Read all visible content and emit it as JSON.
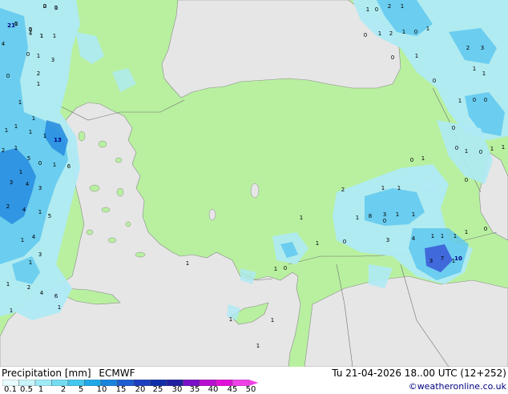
{
  "title": "Precipitation [mm]",
  "model": "ECMWF",
  "datetime": "Tu 21-04-2026 18..00 UTC (12+252)",
  "credit": "©weatheronline.co.uk",
  "colors": {
    "land": "#b8f0a0",
    "sea_outside": "#e6e6e6",
    "precip_light": "#aeeaf5",
    "precip_medium": "#5fc8ef",
    "precip_heavy": "#2a8fe0",
    "precip_intense": "#3c5ed8"
  },
  "colorbar": {
    "ticks": [
      "0.1",
      "0.5",
      "1",
      "2",
      "5",
      "10",
      "15",
      "20",
      "25",
      "30",
      "35",
      "40",
      "45",
      "50"
    ],
    "colors": [
      "#e8fbff",
      "#c8f4fb",
      "#9eeaf6",
      "#73dcf2",
      "#46c8ee",
      "#1ea8e8",
      "#1a84dc",
      "#1e5ed0",
      "#1e3ec0",
      "#102ea8",
      "#2020a0",
      "#7a10c8",
      "#b80ed0",
      "#e010d8",
      "#f040e8"
    ]
  },
  "map_labels": [
    "1",
    "2",
    "1",
    "0",
    "1",
    "4",
    "1",
    "1",
    "0",
    "2",
    "3",
    "1",
    "0",
    "1",
    "1",
    "1",
    "1",
    "1",
    "13",
    "1",
    "1",
    "2",
    "5",
    "0",
    "1",
    "6",
    "1",
    "3",
    "4",
    "3",
    "2",
    "4",
    "1",
    "5",
    "4",
    "1",
    "1",
    "3",
    "1",
    "2",
    "4",
    "6",
    "1",
    "1",
    "1",
    "0",
    "2",
    "1",
    "0",
    "1",
    "2",
    "1",
    "0",
    "1",
    "1",
    "2",
    "3",
    "0",
    "0",
    "0",
    "0",
    "0",
    "0",
    "1",
    "0",
    "1",
    "1",
    "0",
    "0",
    "1",
    "1",
    "1",
    "1",
    "1",
    "3",
    "1",
    "8",
    "1",
    "1",
    "2",
    "1",
    "1",
    "0",
    "3",
    "4",
    "1",
    "1",
    "1",
    "3",
    "7",
    "10",
    "1",
    "0",
    "1",
    "1",
    "1",
    "1",
    "1",
    "4",
    "21",
    "1",
    "1",
    "0",
    "0",
    "0",
    "0",
    "0",
    "1",
    "1"
  ]
}
